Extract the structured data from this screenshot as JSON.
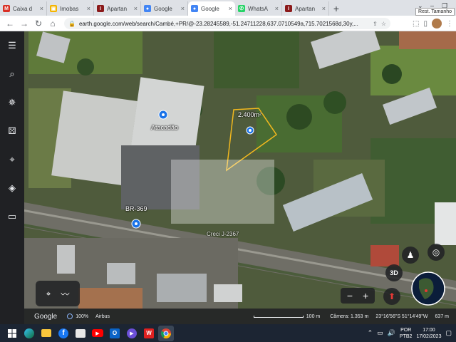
{
  "tabs": [
    {
      "title": "Caixa d",
      "color": "#d93025",
      "glyph": "M"
    },
    {
      "title": "Imobas",
      "color": "#f4b400",
      "glyph": "▣"
    },
    {
      "title": "Apartan",
      "color": "#8b1a1a",
      "glyph": "I"
    },
    {
      "title": "Google",
      "color": "#4285f4",
      "glyph": "●"
    },
    {
      "title": "Google",
      "color": "#4285f4",
      "glyph": "●"
    },
    {
      "title": "WhatsA",
      "color": "#25d366",
      "glyph": "✆"
    },
    {
      "title": "Apartan",
      "color": "#8b1a1a",
      "glyph": "I"
    }
  ],
  "active_tab_index": 4,
  "tooltip": "Rest. Tamanho",
  "address": {
    "url": "earth.google.com/web/search/Cambé,+PR/@-23.28245589,-51.24711228,637.0710549a,715.7021568d,30y,..."
  },
  "map": {
    "labels": {
      "atacadao": "Atacadão",
      "area": "2.400m²",
      "road": "BR-369",
      "watermark": "Creci J-2367"
    },
    "status": {
      "logo": "Google",
      "zoom": "100%",
      "source": "Airbus",
      "scale": "100 m",
      "camera": "Câmera: 1.353 m",
      "coords": "23°16'56\"S 51°14'49\"W",
      "elevation": "637 m"
    },
    "threed": "3D"
  },
  "taskbar": {
    "lang": "POR",
    "layout": "PTB2",
    "time": "17:00",
    "date": "17/02/2023"
  }
}
